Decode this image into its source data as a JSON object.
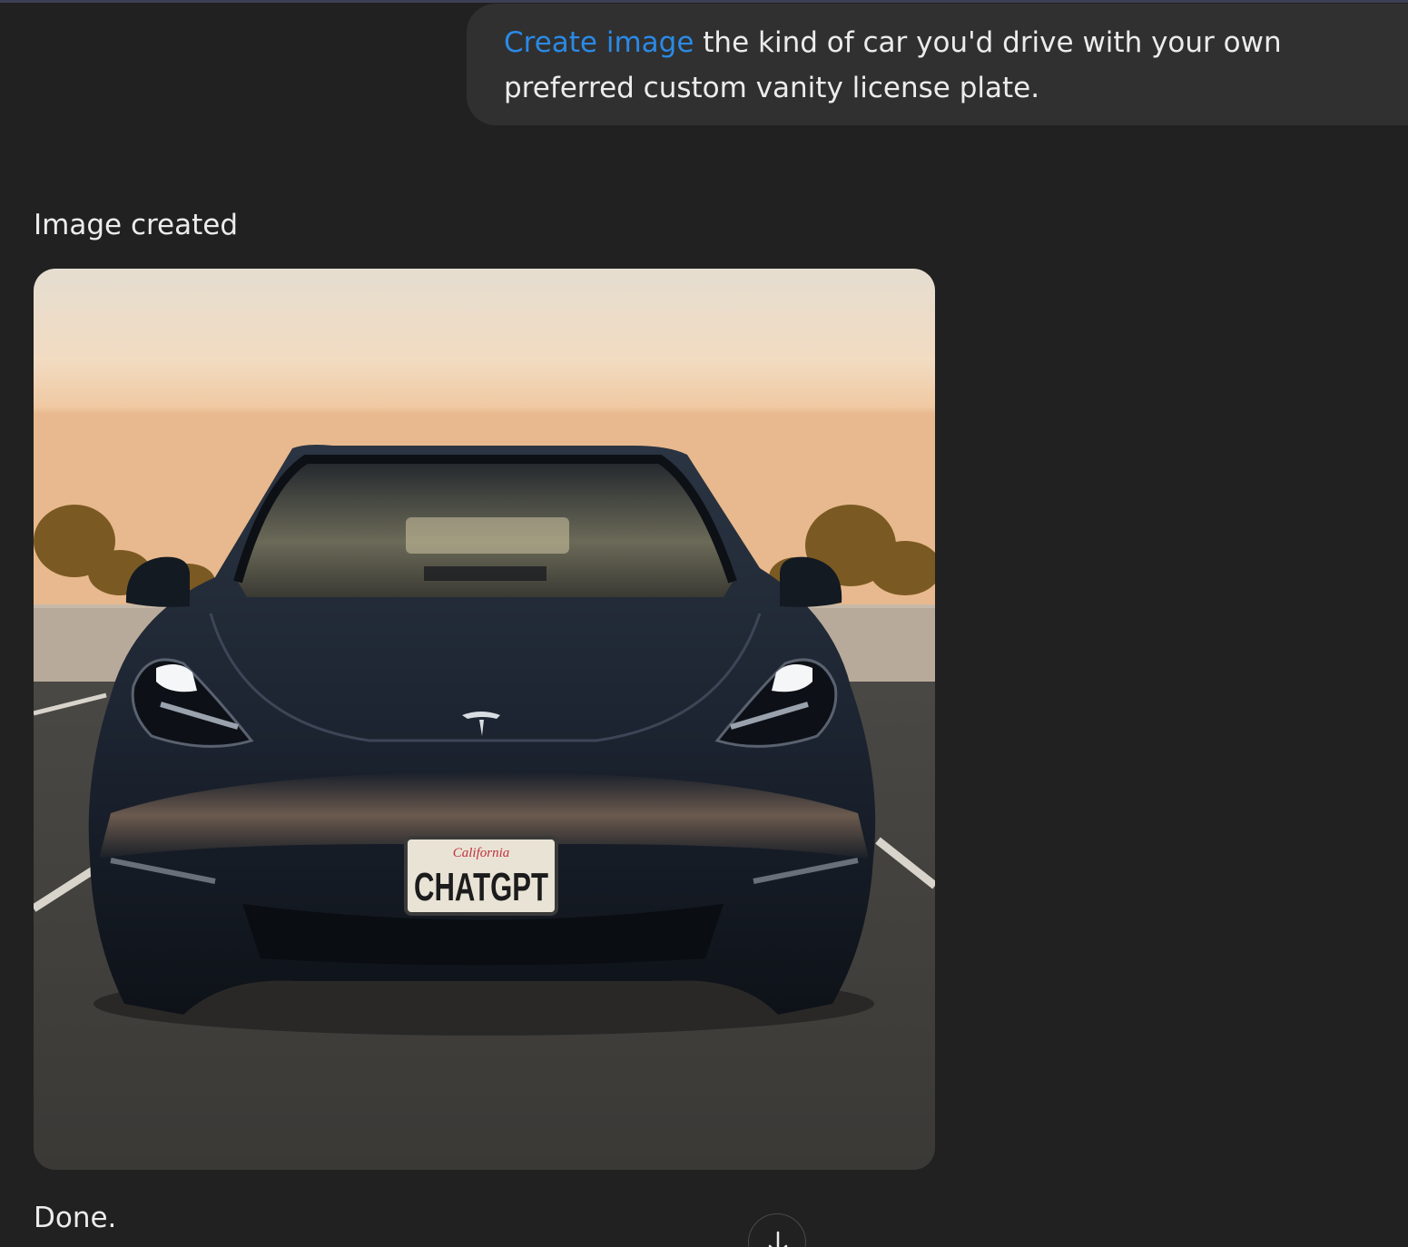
{
  "user_message": {
    "tool_tag": "Create image",
    "text": " the kind of car you'd drive with your own preferred custom vanity license plate."
  },
  "assistant": {
    "status_label": "Image created",
    "image": {
      "plate_state": "California",
      "plate_text": "CHATGPT"
    },
    "reply_text": "Done."
  },
  "colors": {
    "background": "#212121",
    "user_bubble": "#303030",
    "tool_tag": "#2a8ae6",
    "text": "#ececec"
  },
  "icons": {
    "scroll_down": "arrow-down-icon"
  }
}
